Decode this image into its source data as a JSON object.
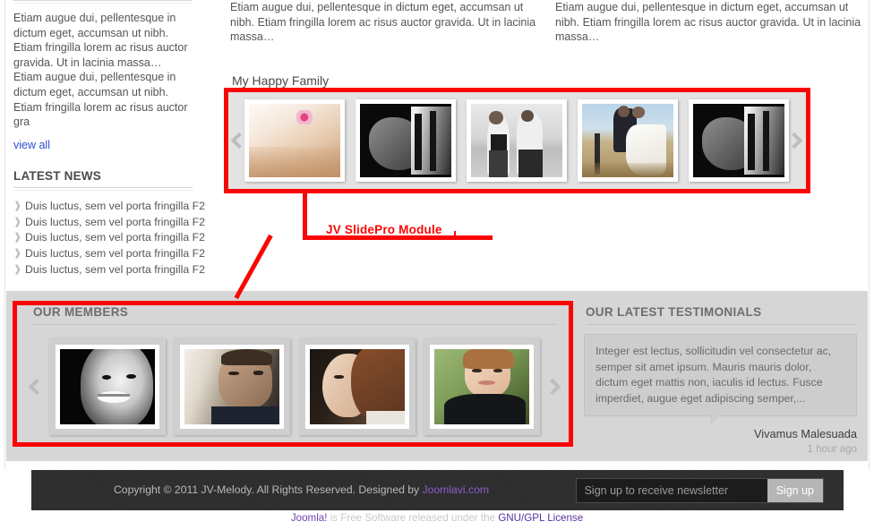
{
  "columns": {
    "left": {
      "lede": "Etiam augue dui, pellentesque in dictum eget, accumsan ut nibh. Etiam fringilla lorem ac risus auctor gravida. Ut in lacinia massa… Etiam augue dui, pellentesque in dictum eget, accumsan ut nibh. Etiam fringilla lorem ac risus auctor gra",
      "view_all": "view all",
      "news_title": "LATEST NEWS",
      "news_items": [
        "Duis luctus, sem vel porta fringilla F2",
        "Duis luctus, sem vel porta fringilla F2",
        "Duis luctus, sem vel porta fringilla F2",
        "Duis luctus, sem vel porta fringilla F2",
        "Duis luctus, sem vel porta fringilla F2"
      ]
    },
    "middle": {
      "lede": "Etiam augue dui, pellentesque in dictum eget, accumsan ut nibh. Etiam fringilla lorem ac risus auctor gravida. Ut in lacinia massa…"
    },
    "right": {
      "lede": "Etiam augue dui, pellentesque in dictum eget, accumsan ut nibh. Etiam fringilla lorem ac risus auctor gravida. Ut in lacinia massa…"
    }
  },
  "slidepro": {
    "heading": "My Happy Family",
    "prev_icon": "chevron-left-icon",
    "next_icon": "chevron-right-icon",
    "slides": [
      {
        "name": "baby-sleeping-photo"
      },
      {
        "name": "hands-closeup-photo"
      },
      {
        "name": "couple-on-beach-photo"
      },
      {
        "name": "wedding-couple-photo"
      },
      {
        "name": "hands-closeup-photo-2"
      }
    ]
  },
  "members": {
    "title": "OUR MEMBERS",
    "prev_icon": "chevron-left-icon",
    "next_icon": "chevron-right-icon",
    "cards": [
      {
        "name": "member-laughing-woman"
      },
      {
        "name": "member-man-portrait"
      },
      {
        "name": "member-woman-profile"
      },
      {
        "name": "member-smiling-woman"
      }
    ]
  },
  "testimonials": {
    "title": "OUR LATEST TESTIMONIALS",
    "quote": "Integer est lectus, sollicitudin vel consectetur ac, semper sit amet ipsum. Mauris mauris dolor, dictum eget mattis non, iaculis id lectus. Fusce imperdiet, augue eget adipiscing semper,...",
    "author": "Vivamus Malesuada",
    "time": "1 hour ago"
  },
  "footer": {
    "copyright_prefix": "Copyright © 2011 JV-Melody. All Rights Reserved. Designed by ",
    "designer_link": "Joomlavi.com",
    "newsletter_placeholder": "Sign up to receive newsletter",
    "newsletter_value": "",
    "signup_label": "Sign up",
    "gpl_brand": "Joomla!",
    "gpl_text": " is Free Software released under the ",
    "gpl_link": "GNU/GPL License"
  },
  "annotations": {
    "slidepro_label": "JV SlidePro Module",
    "highlight_color": "#fa0505"
  }
}
